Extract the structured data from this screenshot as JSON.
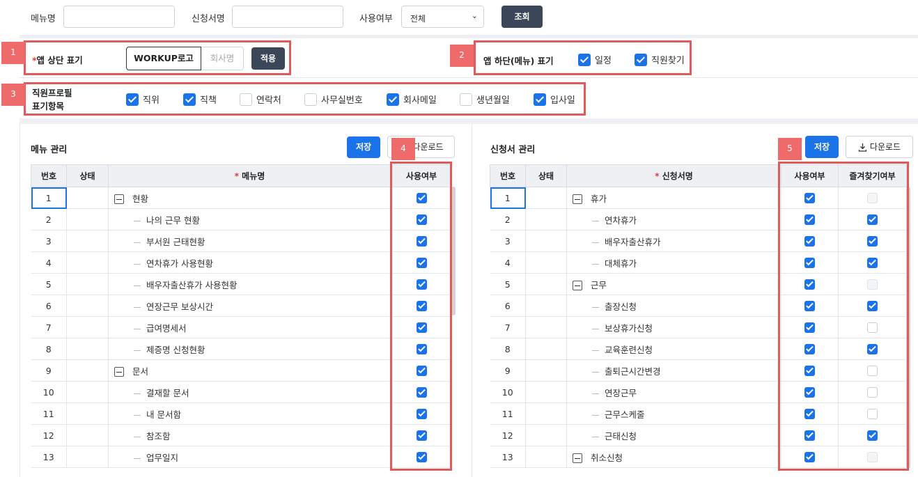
{
  "search": {
    "menu_label": "메뉴명",
    "form_label": "신청서명",
    "use_label": "사용여부",
    "use_select": "전체",
    "search_button": "조회"
  },
  "settings": {
    "top_label": "*앱 상단 표기",
    "top_options": [
      "WORKUP로고",
      "회사명"
    ],
    "apply_button": "적용",
    "bottom_label": "앱 하단(메뉴) 표기",
    "bottom_options": [
      {
        "label": "일정",
        "checked": true
      },
      {
        "label": "직원찾기",
        "checked": true
      }
    ],
    "profile_label_1": "직원프로필",
    "profile_label_2": "표기항목",
    "profile_options": [
      {
        "label": "직위",
        "checked": true
      },
      {
        "label": "직책",
        "checked": true
      },
      {
        "label": "연락처",
        "checked": false
      },
      {
        "label": "사무실번호",
        "checked": false
      },
      {
        "label": "회사메일",
        "checked": true
      },
      {
        "label": "생년월일",
        "checked": false
      },
      {
        "label": "입사일",
        "checked": true
      }
    ]
  },
  "badges": [
    "1",
    "2",
    "3",
    "4",
    "5"
  ],
  "menu_panel": {
    "title": "메뉴 관리",
    "save_button": "저장",
    "download_button": "다운로드",
    "columns": [
      "번호",
      "상태",
      "메뉴명",
      "사용여부"
    ],
    "rows": [
      {
        "no": "1",
        "name": "현황",
        "group": true,
        "use": true
      },
      {
        "no": "2",
        "name": "나의 근무 현황",
        "group": false,
        "use": true
      },
      {
        "no": "3",
        "name": "부서원 근태현황",
        "group": false,
        "use": true
      },
      {
        "no": "4",
        "name": "연차휴가 사용현황",
        "group": false,
        "use": true
      },
      {
        "no": "5",
        "name": "배우자출산휴가 사용현황",
        "group": false,
        "use": true
      },
      {
        "no": "6",
        "name": "연장근무 보상시간",
        "group": false,
        "use": true
      },
      {
        "no": "7",
        "name": "급여명세서",
        "group": false,
        "use": true
      },
      {
        "no": "8",
        "name": "제증명 신청현황",
        "group": false,
        "use": true
      },
      {
        "no": "9",
        "name": "문서",
        "group": true,
        "use": true
      },
      {
        "no": "10",
        "name": "결재할 문서",
        "group": false,
        "use": true
      },
      {
        "no": "11",
        "name": "내 문서함",
        "group": false,
        "use": true
      },
      {
        "no": "12",
        "name": "참조함",
        "group": false,
        "use": true
      },
      {
        "no": "13",
        "name": "업무일지",
        "group": false,
        "use": true
      }
    ]
  },
  "form_panel": {
    "title": "신청서 관리",
    "save_button": "저장",
    "download_button": "다운로드",
    "columns": [
      "번호",
      "상태",
      "신청서명",
      "사용여부",
      "즐겨찾기여부"
    ],
    "rows": [
      {
        "no": "1",
        "name": "휴가",
        "group": true,
        "use": true,
        "fav": "disabled"
      },
      {
        "no": "2",
        "name": "연차휴가",
        "group": false,
        "use": true,
        "fav": "on"
      },
      {
        "no": "3",
        "name": "배우자출산휴가",
        "group": false,
        "use": true,
        "fav": "on"
      },
      {
        "no": "4",
        "name": "대체휴가",
        "group": false,
        "use": true,
        "fav": "on"
      },
      {
        "no": "5",
        "name": "근무",
        "group": true,
        "use": true,
        "fav": "disabled"
      },
      {
        "no": "6",
        "name": "출장신청",
        "group": false,
        "use": true,
        "fav": "on"
      },
      {
        "no": "7",
        "name": "보상휴가신청",
        "group": false,
        "use": true,
        "fav": "off"
      },
      {
        "no": "8",
        "name": "교육훈련신청",
        "group": false,
        "use": true,
        "fav": "on"
      },
      {
        "no": "9",
        "name": "출퇴근시간변경",
        "group": false,
        "use": true,
        "fav": "off"
      },
      {
        "no": "10",
        "name": "연장근무",
        "group": false,
        "use": true,
        "fav": "off"
      },
      {
        "no": "11",
        "name": "근무스케줄",
        "group": false,
        "use": true,
        "fav": "off"
      },
      {
        "no": "12",
        "name": "근태신청",
        "group": false,
        "use": true,
        "fav": "on"
      },
      {
        "no": "13",
        "name": "취소신청",
        "group": true,
        "use": true,
        "fav": "disabled"
      }
    ]
  },
  "colors": {
    "accent": "#1a73e8",
    "dark_button": "#3c4659",
    "annotation": "#e05a5a"
  },
  "icons": {
    "download": "download-icon",
    "tree_collapse": "minus-square-icon",
    "select": "chevron-down-icon"
  }
}
